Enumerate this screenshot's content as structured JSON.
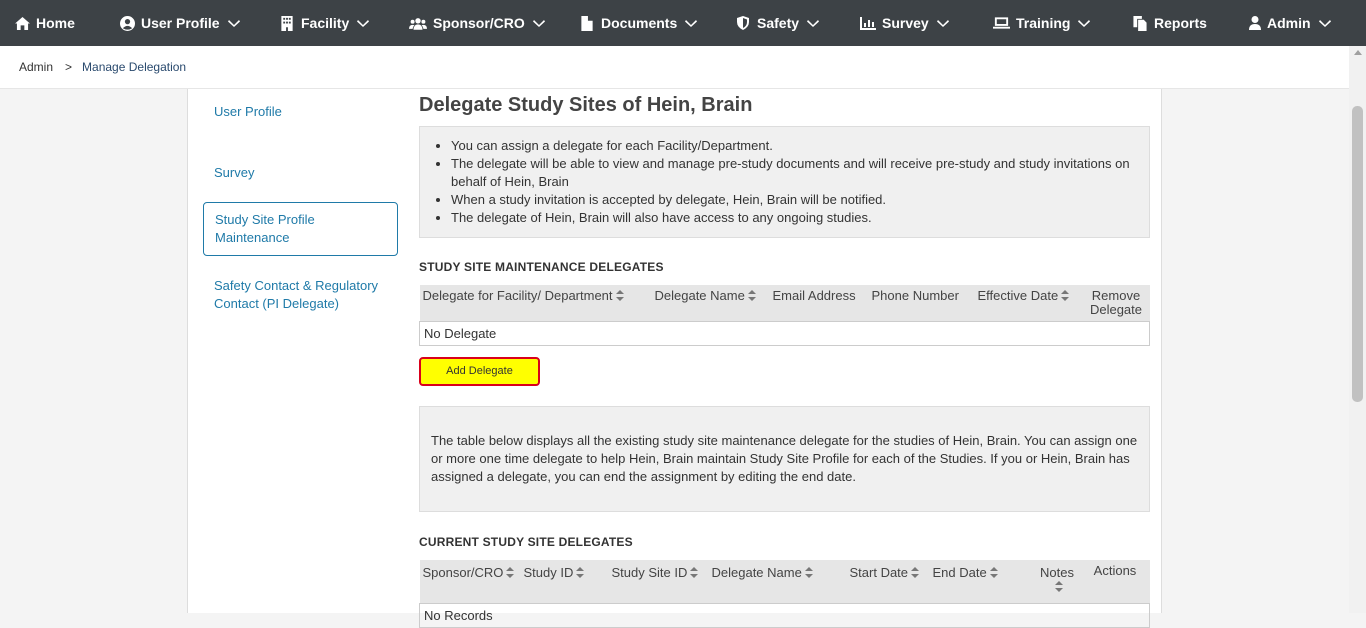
{
  "nav": {
    "items": [
      {
        "label": "Home",
        "icon": "home-icon",
        "dropdown": false
      },
      {
        "label": "User Profile",
        "icon": "user-circle-icon",
        "dropdown": true
      },
      {
        "label": "Facility",
        "icon": "building-icon",
        "dropdown": true
      },
      {
        "label": "Sponsor/CRO",
        "icon": "users-icon",
        "dropdown": true
      },
      {
        "label": "Documents",
        "icon": "file-icon",
        "dropdown": true
      },
      {
        "label": "Safety",
        "icon": "shield-icon",
        "dropdown": true
      },
      {
        "label": "Survey",
        "icon": "bar-chart-icon",
        "dropdown": true
      },
      {
        "label": "Training",
        "icon": "laptop-icon",
        "dropdown": true
      },
      {
        "label": "Reports",
        "icon": "copy-icon",
        "dropdown": false
      },
      {
        "label": "Admin",
        "icon": "user-icon",
        "dropdown": true
      }
    ]
  },
  "breadcrumb": {
    "root": "Admin",
    "separator": ">",
    "current": "Manage Delegation"
  },
  "sidebar": {
    "items": [
      {
        "label": "User Profile",
        "active": false
      },
      {
        "label": "Survey",
        "active": false
      },
      {
        "label": "Study Site Profile Maintenance",
        "active": true
      },
      {
        "label": "Safety Contact & Regulatory Contact (PI Delegate)",
        "active": false
      }
    ]
  },
  "main": {
    "title": "Delegate Study Sites of Hein, Brain",
    "info_bullets": [
      "You can assign a delegate for each Facility/Department.",
      "The delegate will be able to view and manage pre-study documents and will receive pre-study and study invitations on behalf of Hein, Brain",
      "When a study invitation is accepted by delegate, Hein, Brain will be notified.",
      "The delegate of Hein, Brain will also have access to any ongoing studies."
    ],
    "maintenance_section_title": "STUDY SITE MAINTENANCE DELEGATES",
    "maintenance_table": {
      "columns": [
        "Delegate for Facility/ Department",
        "Delegate Name",
        "Email Address",
        "Phone Number",
        "Effective Date",
        "Remove Delegate"
      ],
      "empty_text": "No Delegate"
    },
    "add_button": "Add Delegate",
    "description": "The table below displays all the existing study site maintenance delegate for the studies of Hein, Brain. You can assign one or more one time delegate to help Hein, Brain maintain Study Site Profile for each of the Studies. If you or Hein, Brain has assigned a delegate, you can end the assignment by editing the end date.",
    "current_section_title": "CURRENT STUDY SITE DELEGATES",
    "current_table": {
      "columns": [
        "Sponsor/CRO",
        "Study ID",
        "Study Site ID",
        "Delegate Name",
        "Start Date",
        "End Date",
        "Notes",
        "Actions"
      ],
      "empty_text": "No Records"
    }
  },
  "colors": {
    "nav_bg": "#3d4246",
    "link": "#1f7aa8",
    "add_button_bg": "#ffff00",
    "add_button_border": "#d9001b"
  }
}
